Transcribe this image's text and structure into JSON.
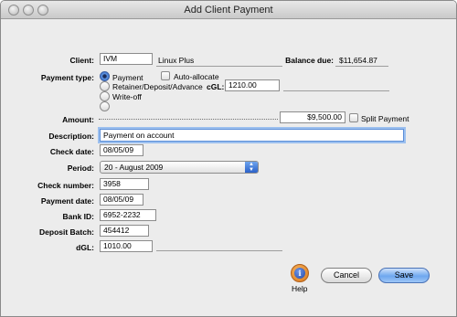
{
  "window": {
    "title": "Add Client Payment"
  },
  "labels": {
    "client": "Client:",
    "balance_due": "Balance due:",
    "payment_type": "Payment type:",
    "amount": "Amount:",
    "description": "Description:",
    "check_date": "Check date:",
    "period": "Period:",
    "check_number": "Check number:",
    "payment_date": "Payment date:",
    "bank_id": "Bank ID:",
    "deposit_batch": "Deposit Batch:",
    "dgl": "dGL:",
    "cgl": "cGL:"
  },
  "client": {
    "code": "IVM",
    "name": "Linux Plus"
  },
  "balance_due_value": "$11,654.87",
  "payment_type": {
    "options": [
      "Payment",
      "Retainer/Deposit/Advance",
      "Write-off",
      ""
    ],
    "selected_index": 0,
    "auto_allocate_label": "Auto-allocate",
    "cgl_value": "1210.00"
  },
  "amount": {
    "value": "$9,500.00",
    "split_label": "Split Payment"
  },
  "description": "Payment on account",
  "check_date": "08/05/09",
  "period": "20 - August 2009",
  "check_number": "3958",
  "payment_date": "08/05/09",
  "bank_id": "6952-2232",
  "deposit_batch": "454412",
  "dgl": "1010.00",
  "buttons": {
    "help": "Help",
    "cancel": "Cancel",
    "save": "Save"
  },
  "icons": {
    "help": "help-icon"
  },
  "colors": {
    "accent": "#2f64c4",
    "help_orange": "#d9781c"
  }
}
